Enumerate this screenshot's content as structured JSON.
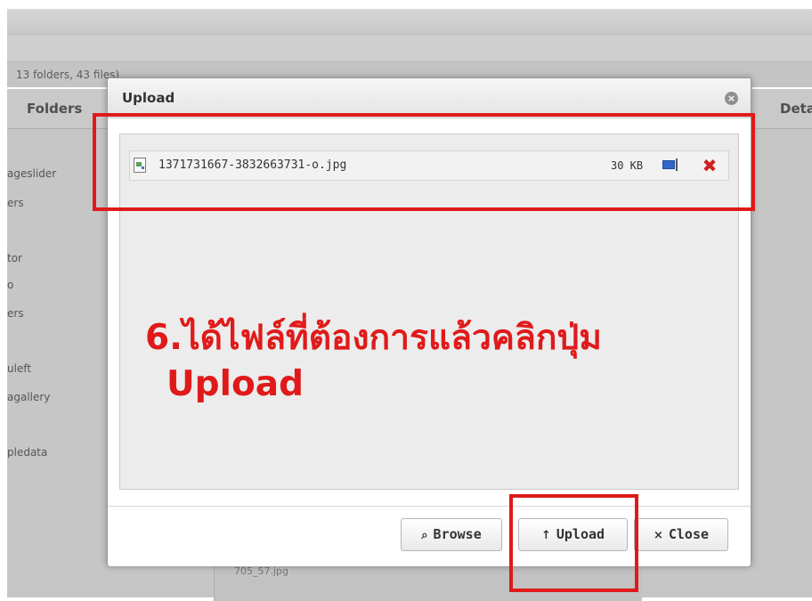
{
  "background": {
    "stats": "13 folders, 43 files)",
    "folders_header": "Folders",
    "details_header": "Detai",
    "sidebar_items": [
      "ageslider",
      "ers",
      "tor",
      "o",
      "ers",
      "uleft",
      "agallery",
      "pledata"
    ],
    "list_row": "705_57.jpg"
  },
  "modal": {
    "title": "Upload",
    "close_glyph": "×",
    "file": {
      "name": "1371731667-3832663731-o.jpg",
      "size": "30 KB",
      "remove_glyph": "✖"
    },
    "buttons": {
      "browse_icon": "⌕",
      "browse": "Browse",
      "upload_icon": "↑",
      "upload": "Upload",
      "close_icon": "×",
      "close": "Close"
    }
  },
  "annotation": {
    "line1": "6.ได้ไฟล์ที่ต้องการแล้วคลิกปุ่ม",
    "line2": "Upload",
    "color": "#e01a1a"
  }
}
